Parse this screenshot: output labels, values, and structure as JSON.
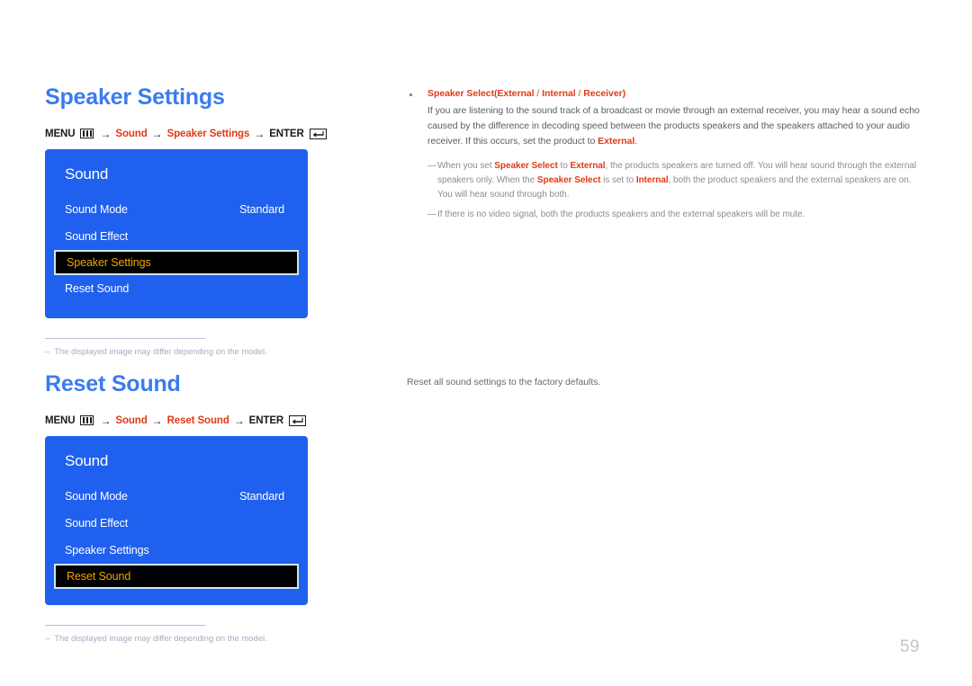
{
  "document": {
    "page_number": "59"
  },
  "sections": [
    {
      "id": "speaker-settings",
      "title": "Speaker Settings",
      "breadcrumb": {
        "menu_label": "MENU",
        "menu_icon": "menu-bars-icon",
        "arrow": "→",
        "path_1": "Sound",
        "path_2": "Speaker Settings",
        "enter_label": "ENTER",
        "enter_icon": "enter-return-icon"
      },
      "osd": {
        "title": "Sound",
        "rows": [
          {
            "label": "Sound Mode",
            "value": "Standard",
            "selected": false
          },
          {
            "label": "Sound Effect",
            "value": "",
            "selected": false
          },
          {
            "label": "Speaker Settings",
            "value": "",
            "selected": true
          },
          {
            "label": "Reset Sound",
            "value": "",
            "selected": false
          }
        ]
      },
      "footnote": {
        "dash": "–",
        "text": "The displayed image may differ depending on the model."
      }
    },
    {
      "id": "reset-sound",
      "title": "Reset Sound",
      "breadcrumb": {
        "menu_label": "MENU",
        "menu_icon": "menu-bars-icon",
        "arrow": "→",
        "path_1": "Sound",
        "path_2": "Reset Sound",
        "enter_label": "ENTER",
        "enter_icon": "enter-return-icon"
      },
      "osd": {
        "title": "Sound",
        "rows": [
          {
            "label": "Sound Mode",
            "value": "Standard",
            "selected": false
          },
          {
            "label": "Sound Effect",
            "value": "",
            "selected": false
          },
          {
            "label": "Speaker Settings",
            "value": "",
            "selected": false
          },
          {
            "label": "Reset Sound",
            "value": "",
            "selected": true
          }
        ]
      },
      "footnote": {
        "dash": "–",
        "text": "The displayed image may differ depending on the model."
      }
    }
  ],
  "right_column": {
    "bullet": {
      "marker": "square-bullet",
      "heading_main": "Speaker Select",
      "heading_paren_open": "(",
      "heading_opt_1": "External",
      "heading_sep_1": " / ",
      "heading_opt_2": "Internal",
      "heading_sep_2": " / ",
      "heading_opt_3": "Receiver",
      "heading_paren_close": ")",
      "body_part_1": "If you are listening to the sound track of a broadcast or movie through an external receiver, you may hear a sound echo caused by the difference in decoding speed between the products speakers and the speakers attached to your audio receiver. If this occurs, set the product to ",
      "body_hl_1": "External",
      "body_part_2": "."
    },
    "notes": [
      {
        "dash": "—",
        "part_1": "When you set ",
        "hl_1": "Speaker Select",
        "part_2": " to ",
        "hl_2": "External",
        "part_3": ", the products speakers are turned off. You will hear sound through the external speakers only. When the ",
        "hl_3": "Speaker Select",
        "part_4": " is set to ",
        "hl_4": "Internal",
        "part_5": ", both the product speakers and the external speakers are on. You will hear sound through both."
      },
      {
        "dash": "—",
        "part_1": "If there is no video signal, both the products speakers and the external speakers will be mute.",
        "hl_1": "",
        "part_2": "",
        "hl_2": "",
        "part_3": "",
        "hl_3": "",
        "part_4": "",
        "hl_4": "",
        "part_5": ""
      }
    ],
    "reset_description": "Reset all sound settings to the factory defaults."
  },
  "colors": {
    "heading_blue": "#3a7ced",
    "osd_blue": "#2060ee",
    "accent_red": "#e03a17",
    "highlight_gold": "#f0a500",
    "highlight_bg": "#000000",
    "highlight_border": "#cfe6f5",
    "footnote_gray": "#a6adc4",
    "body_gray": "#5d5d5d",
    "page_number_gray": "#c4c4c4"
  }
}
